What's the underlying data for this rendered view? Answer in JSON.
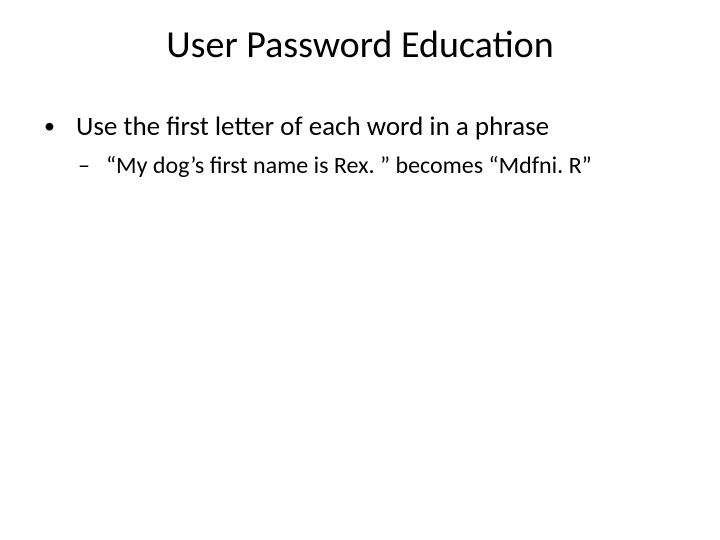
{
  "title": "User Password Education",
  "bullets": [
    {
      "text": "Use the first letter of each word in a phrase",
      "sub": [
        {
          "text": "“My dog’s first name is Rex. ” becomes “Mdfni. R”"
        }
      ]
    }
  ]
}
